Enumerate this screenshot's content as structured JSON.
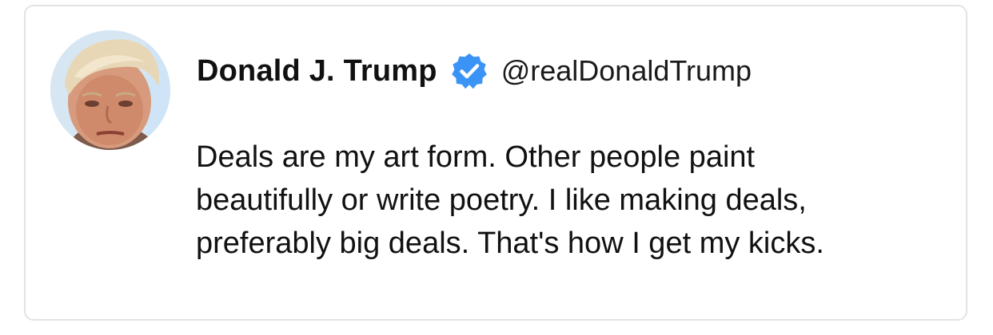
{
  "tweet": {
    "author": {
      "display_name": "Donald J. Trump",
      "handle": "@realDonaldTrump",
      "verified": true,
      "verified_icon": "verified-badge-icon",
      "verified_color": "#3b94f5"
    },
    "text_lines": [
      "Deals are my art form. Other people paint",
      "beautifully or write poetry. I like making deals,",
      "preferably big deals. That's how I get my kicks."
    ]
  }
}
